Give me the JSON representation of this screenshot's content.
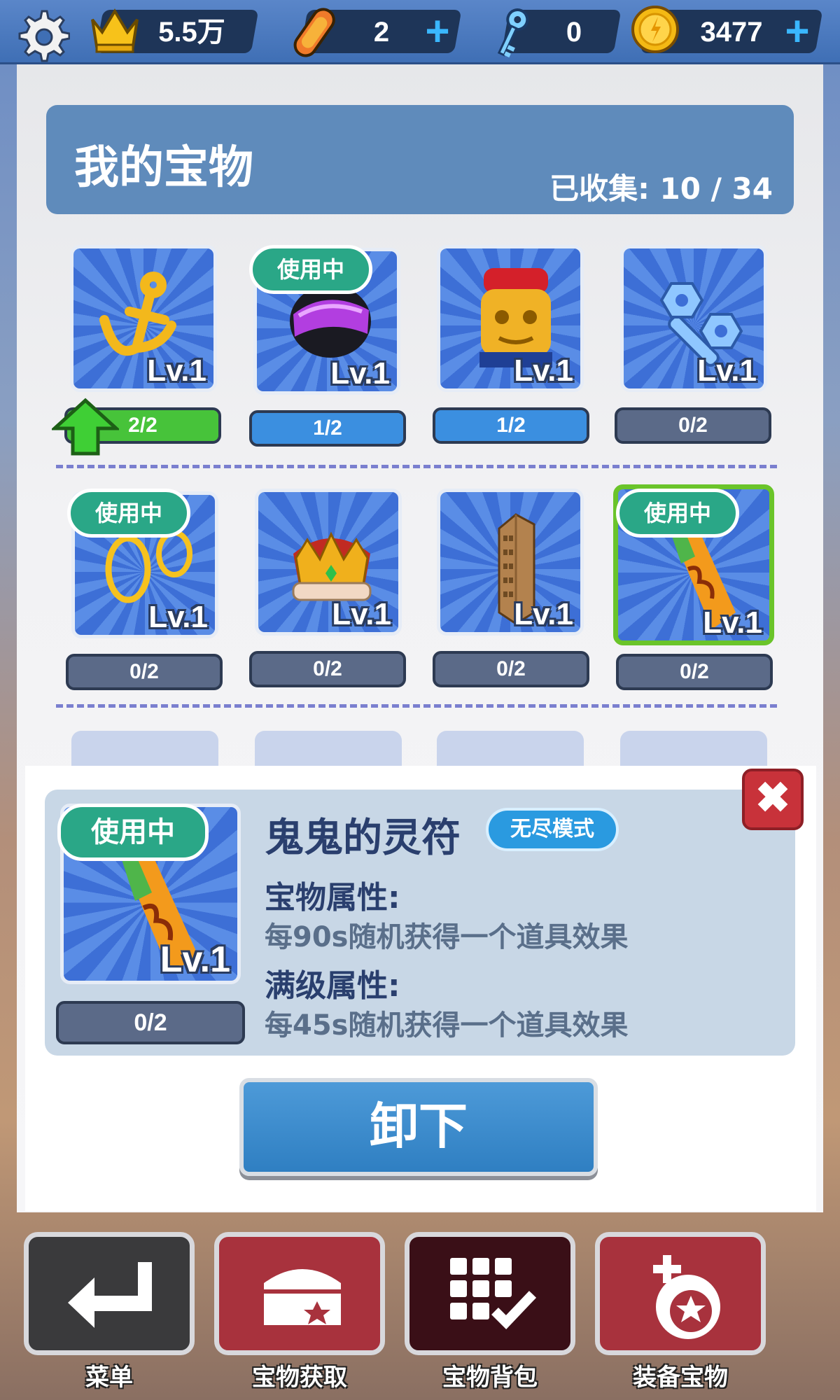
{
  "topbar": {
    "crown_value": "5.5万",
    "boards_value": "2",
    "keys_value": "0",
    "coins_value": "3477",
    "plus_glyph": "+"
  },
  "header": {
    "title": "我的宝物",
    "collected_label": "已收集:",
    "collected_value": "10 / 34"
  },
  "treasures": [
    {
      "level": "Lv.1",
      "progress": "2/2",
      "in_use": false,
      "upgradable": true,
      "icon": "anchor-icon",
      "fill": 1.0
    },
    {
      "level": "Lv.1",
      "progress": "1/2",
      "in_use": true,
      "icon": "helmet-icon",
      "fill": 1.0
    },
    {
      "level": "Lv.1",
      "progress": "1/2",
      "in_use": false,
      "icon": "mask-icon",
      "fill": 1.0
    },
    {
      "level": "Lv.1",
      "progress": "0/2",
      "in_use": false,
      "icon": "wrench-icon",
      "fill": 0
    },
    {
      "level": "Lv.1",
      "progress": "0/2",
      "in_use": true,
      "icon": "rings-icon",
      "fill": 0
    },
    {
      "level": "Lv.1",
      "progress": "0/2",
      "in_use": false,
      "icon": "crown-icon",
      "fill": 0
    },
    {
      "level": "Lv.1",
      "progress": "0/2",
      "in_use": false,
      "icon": "tower-icon",
      "fill": 0
    },
    {
      "level": "Lv.1",
      "progress": "0/2",
      "in_use": true,
      "selected": true,
      "icon": "talisman-icon",
      "fill": 0
    }
  ],
  "badges": {
    "in_use": "使用中"
  },
  "detail": {
    "name": "鬼鬼的灵符",
    "mode": "无尽模式",
    "attr_label": "宝物属性:",
    "attr_value": "每90s随机获得一个道具效果",
    "max_label": "满级属性:",
    "max_value": "每45s随机获得一个道具效果",
    "level": "Lv.1",
    "progress": "0/2",
    "in_use": "使用中",
    "close_glyph": "✖",
    "unequip_label": "卸下"
  },
  "nav": {
    "menu": "菜单",
    "obtain": "宝物获取",
    "backpack": "宝物背包",
    "equip": "装备宝物"
  },
  "colors": {
    "green": "#6ac42a",
    "blue_fill": "#3b8fe0",
    "teal_badge": "#2aa787",
    "red_button": "#a8323d",
    "dark_button": "#3a3a3c",
    "dark_maroon": "#3a0f17"
  }
}
